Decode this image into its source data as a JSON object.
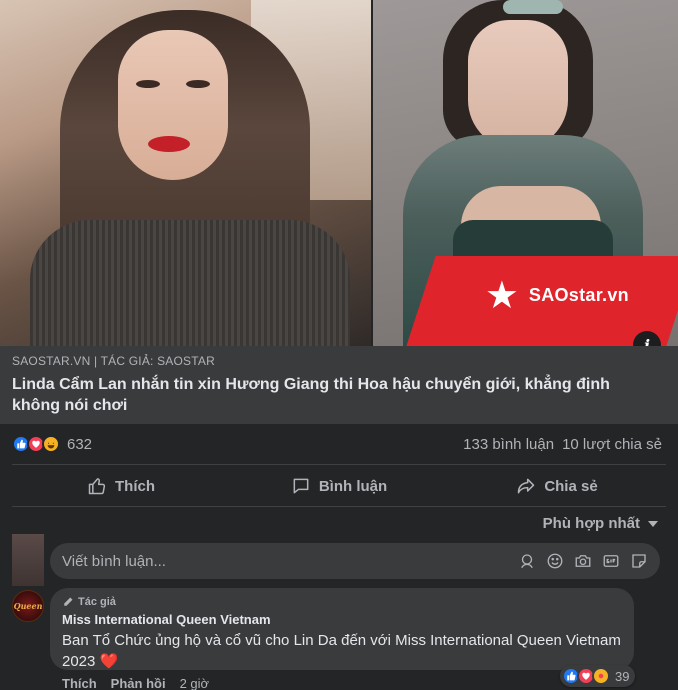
{
  "image": {
    "watermark": "SAOstar.vn",
    "info_icon": "info-icon"
  },
  "link": {
    "source": "SAOSTAR.VN | TÁC GIẢ: SAOSTAR",
    "title": "Linda Cẩm Lan nhắn tin xin Hương Giang thi Hoa hậu chuyển giới, khẳng định không nói chơi"
  },
  "stats": {
    "reactions": [
      "like",
      "love",
      "haha"
    ],
    "reaction_count": "632",
    "comments": "133 bình luận",
    "shares": "10 lượt chia sẻ"
  },
  "actions": {
    "like": "Thích",
    "comment": "Bình luận",
    "share": "Chia sẻ"
  },
  "sort": {
    "label": "Phù hợp nhất"
  },
  "composer": {
    "placeholder": "Viết bình luận...",
    "icons": [
      "sticker-face-icon",
      "emoji-icon",
      "camera-icon",
      "gif-icon",
      "sticker-icon"
    ]
  },
  "comment": {
    "badge": "Tác giả",
    "author": "Miss International Queen Vietnam",
    "text": "Ban Tổ Chức ủng hộ và cổ vũ cho Lin Da đến với Miss International Queen Vietnam 2023",
    "heart": "❤️",
    "reactions": [
      "like",
      "love",
      "care"
    ],
    "reaction_count": "39",
    "like_label": "Thích",
    "reply_label": "Phản hồi",
    "time": "2 giờ",
    "avatar_text": "Queen"
  },
  "colors": {
    "background": "#242526",
    "card": "#3a3b3c",
    "text_primary": "#e4e6eb",
    "text_secondary": "#b0b3b8",
    "like_blue": "#2078f4",
    "love_red": "#f33e58",
    "haha_yellow": "#f7b125",
    "brand_red": "#e0242b"
  }
}
